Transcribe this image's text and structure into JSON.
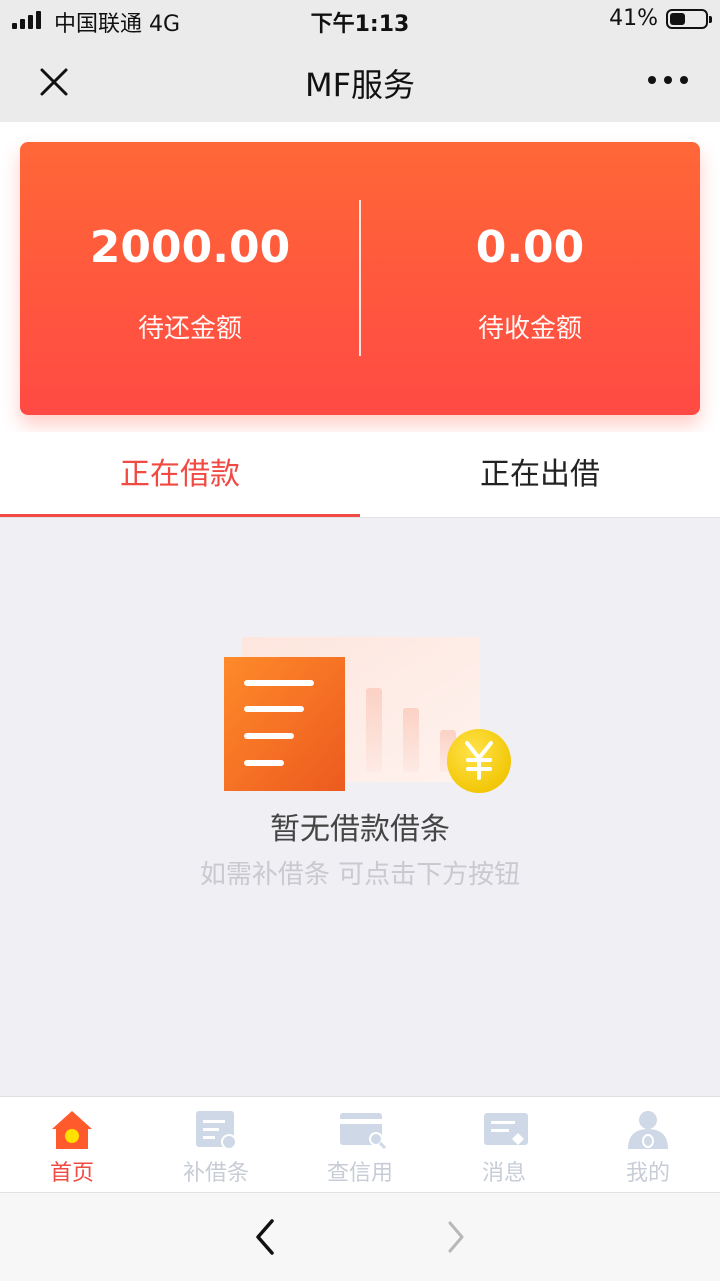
{
  "status_bar": {
    "carrier": "中国联通  4G",
    "time": "下午1:13",
    "battery": "41%"
  },
  "nav": {
    "title": "MF服务",
    "close_icon": "close-icon",
    "more_icon": "more-icon"
  },
  "summary": {
    "repay": {
      "amount": "2000.00",
      "label": "待还金额"
    },
    "receive": {
      "amount": "0.00",
      "label": "待收金额"
    }
  },
  "tabs": [
    {
      "label": "正在借款",
      "active": true
    },
    {
      "label": "正在出借",
      "active": false
    }
  ],
  "empty_state": {
    "message": "暂无借款借条",
    "hint": "如需补借条 可点击下方按钮"
  },
  "tabbar": [
    {
      "label": "首页",
      "icon": "home-icon",
      "active": true
    },
    {
      "label": "补借条",
      "icon": "supplement-note-icon",
      "active": false
    },
    {
      "label": "查信用",
      "icon": "credit-check-icon",
      "active": false
    },
    {
      "label": "消息",
      "icon": "message-icon",
      "active": false
    },
    {
      "label": "我的",
      "icon": "profile-icon",
      "active": false
    }
  ],
  "colors": {
    "accent": "#f04a43",
    "card_top": "#ff6737",
    "card_bottom": "#ff4a44",
    "tab_inactive": "#c7ccd6"
  }
}
